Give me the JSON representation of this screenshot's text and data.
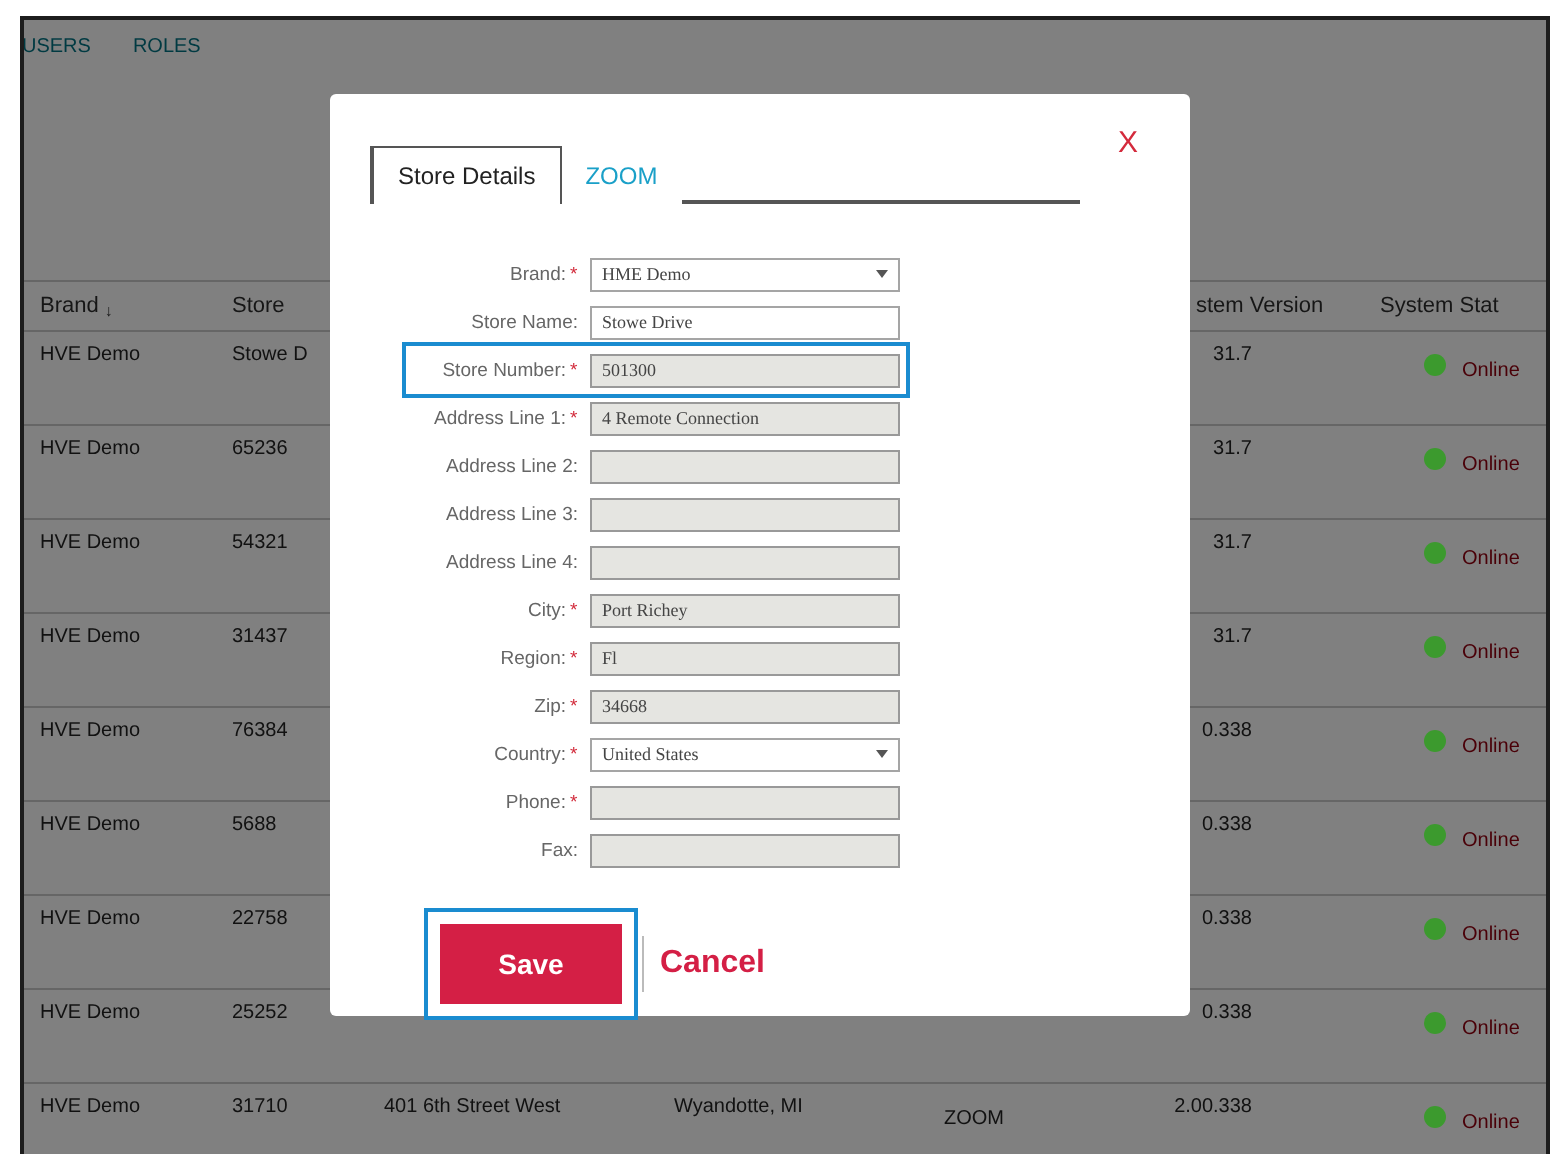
{
  "nav": [
    {
      "label": "USERS"
    },
    {
      "label": "ROLES"
    }
  ],
  "table": {
    "columns": [
      {
        "label": "Brand",
        "sort_mark": "↓"
      },
      {
        "label": "Store"
      },
      {
        "label": "stem Version"
      },
      {
        "label": "System Stat"
      }
    ],
    "rows": [
      {
        "brand": "HVE Demo",
        "store": "Stowe D",
        "version": "31.7",
        "status": "Online",
        "color": "#3c9a2e"
      },
      {
        "brand": "HVE Demo",
        "store": "65236",
        "version": "31.7",
        "status": "Online",
        "color": "#3c9a2e"
      },
      {
        "brand": "HVE Demo",
        "store": "54321",
        "version": "31.7",
        "status": "Online",
        "color": "#3c9a2e"
      },
      {
        "brand": "HVE Demo",
        "store": "31437",
        "version": "31.7",
        "status": "Online",
        "color": "#3c9a2e"
      },
      {
        "brand": "HVE Demo",
        "store": "76384",
        "version": "0.338",
        "status": "Online",
        "color": "#3c9a2e"
      },
      {
        "brand": "HVE Demo",
        "store": "5688",
        "version": "0.338",
        "status": "Online",
        "color": "#3c9a2e"
      },
      {
        "brand": "HVE Demo",
        "store": "22758",
        "version": "0.338",
        "status": "Online",
        "color": "#3c9a2e"
      },
      {
        "brand": "HVE Demo",
        "store": "25252",
        "version": "0.338",
        "status": "Online",
        "color": "#3c9a2e"
      },
      {
        "brand": "HVE Demo",
        "store": "31710",
        "address": "401 6th Street West",
        "city": "Wyandotte, MI",
        "type": "ZOOM",
        "version": "2.00.338",
        "status": "Online",
        "color": "#3c9a2e"
      }
    ]
  },
  "modal": {
    "close": "X",
    "tabs": [
      {
        "label": "Store Details",
        "selected": true
      },
      {
        "label": "ZOOM",
        "selected": false
      }
    ],
    "fields": [
      {
        "label": "Brand:",
        "required_mark": "*",
        "kind": "select",
        "value": "HME Demo",
        "disabled": false,
        "highlighted": false
      },
      {
        "label": "Store Name:",
        "kind": "text",
        "value": "Stowe Drive",
        "disabled": false,
        "highlighted": false
      },
      {
        "label": "Store Number:",
        "required_mark": "*",
        "kind": "text",
        "value": "501300",
        "disabled": true,
        "highlighted": true
      },
      {
        "label": "Address Line 1:",
        "required_mark": "*",
        "kind": "text",
        "value": "4 Remote Connection",
        "disabled": true,
        "highlighted": false
      },
      {
        "label": "Address Line 2:",
        "kind": "text",
        "disabled": true,
        "highlighted": false
      },
      {
        "label": "Address Line 3:",
        "kind": "text",
        "disabled": true,
        "highlighted": false
      },
      {
        "label": "Address Line 4:",
        "kind": "text",
        "disabled": true,
        "highlighted": false
      },
      {
        "label": "City:",
        "required_mark": "*",
        "kind": "text",
        "value": "Port Richey",
        "disabled": true,
        "highlighted": false
      },
      {
        "label": "Region:",
        "required_mark": "*",
        "kind": "text",
        "value": "Fl",
        "disabled": true,
        "highlighted": false
      },
      {
        "label": "Zip:",
        "required_mark": "*",
        "kind": "text",
        "value": "34668",
        "disabled": true,
        "highlighted": false
      },
      {
        "label": "Country:",
        "required_mark": "*",
        "kind": "select",
        "value": "United States",
        "disabled": false,
        "highlighted": false
      },
      {
        "label": "Phone:",
        "required_mark": "*",
        "kind": "text",
        "disabled": true,
        "highlighted": false
      },
      {
        "label": "Fax:",
        "kind": "text",
        "disabled": true,
        "highlighted": false
      }
    ],
    "buttons": [
      {
        "label": "Save",
        "kind": "primary",
        "highlighted": true
      },
      {
        "label": "Cancel",
        "kind": "link",
        "highlighted": false
      }
    ]
  }
}
